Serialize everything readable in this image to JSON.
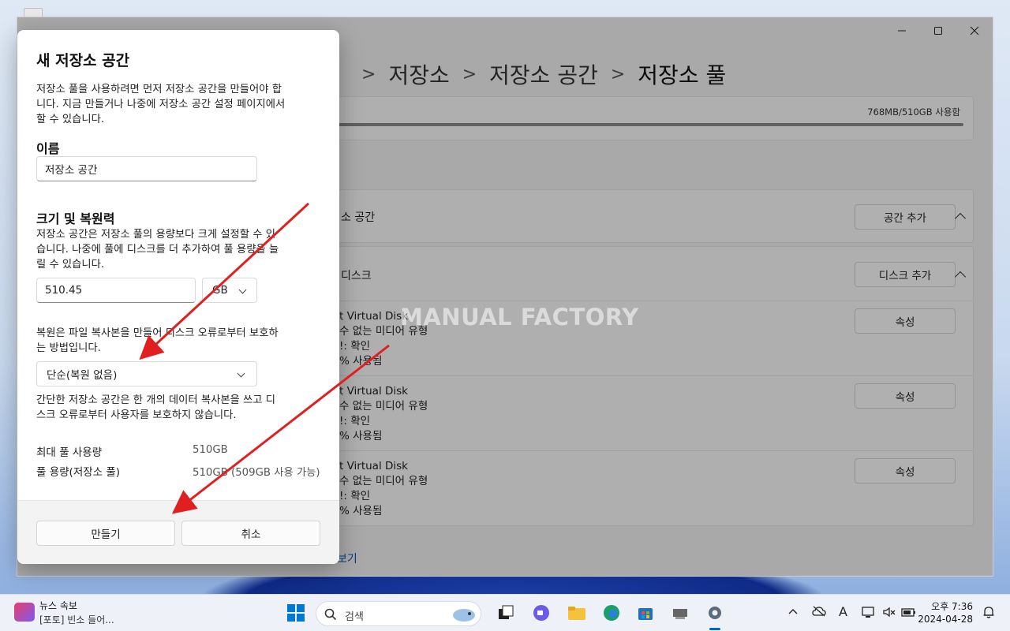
{
  "window": {
    "breadcrumb": [
      ">",
      "저장소",
      ">",
      "저장소 공간",
      ">",
      "저장소 풀"
    ],
    "usage_text": "768MB/510GB 사용함",
    "spaces_section_title": "소 공간",
    "add_space_button": "공간 추가",
    "disks_section_title": "디스크",
    "add_disk_button": "디스크 추가",
    "disks": [
      {
        "name": "t Virtual Disk",
        "media": "수 없는 미디어 유형",
        "status": "확인",
        "usage": "% 사용됨",
        "properties": "속성"
      },
      {
        "name": "t Virtual Disk",
        "media": "수 없는 미디어 유형",
        "status": "확인",
        "usage": "% 사용됨",
        "properties": "속성"
      },
      {
        "name": "t Virtual Disk",
        "media": "수 없는 미디어 유형",
        "status": "확인",
        "usage": "% 사용됨",
        "properties": "속성"
      }
    ],
    "bottom_link": "보기",
    "status_prefix": "I:",
    "disk_prefix": "I"
  },
  "watermark": "MANUAL FACTORY",
  "dialog": {
    "title": "새 저장소 공간",
    "intro_l1": "저장소 풀을 사용하려면 먼저 저장소 공간을 만들어야 합",
    "intro_l2": "니다. 지금 만들거나 나중에 저장소 공간 설정 페이지에서",
    "intro_l3": "할 수 있습니다.",
    "name_label": "이름",
    "name_value": "저장소 공간",
    "size_label": "크기 및 복원력",
    "size_desc_l1": "저장소 공간은 저장소 풀의 용량보다 크게 설정할 수 있",
    "size_desc_l2": "습니다. 나중에 풀에 디스크를 더 추가하여 풀 용량을 늘",
    "size_desc_l3": "릴 수 있습니다.",
    "size_value": "510.45",
    "size_unit": "GB",
    "resiliency_desc_l1": "복원은 파일 복사본을 만들어 디스크 오류로부터 보호하",
    "resiliency_desc_l2": "는 방법입니다.",
    "resiliency_value": "단순(복원 없음)",
    "resiliency_note_l1": "간단한 저장소 공간은 한 개의 데이터 복사본을 쓰고 디",
    "resiliency_note_l2": "스크 오류로부터 사용자를 보호하지 않습니다.",
    "max_pool_label": "최대 풀 사용량",
    "max_pool_value": "510GB",
    "pool_capacity_label": "풀 용량(저장소 풀)",
    "pool_capacity_value": "510GB (509GB 사용 가능)",
    "create_button": "만들기",
    "cancel_button": "취소"
  },
  "taskbar": {
    "news_title": "뉴스 속보",
    "news_subtitle": "[포토] 빈소 들어...",
    "search_placeholder": "검색",
    "clock_time": "오후 7:36",
    "clock_date": "2024-04-28",
    "input_indicator": "A"
  },
  "colors": {
    "accent": "#0067c0",
    "annotation_arrow": "#e02020"
  }
}
